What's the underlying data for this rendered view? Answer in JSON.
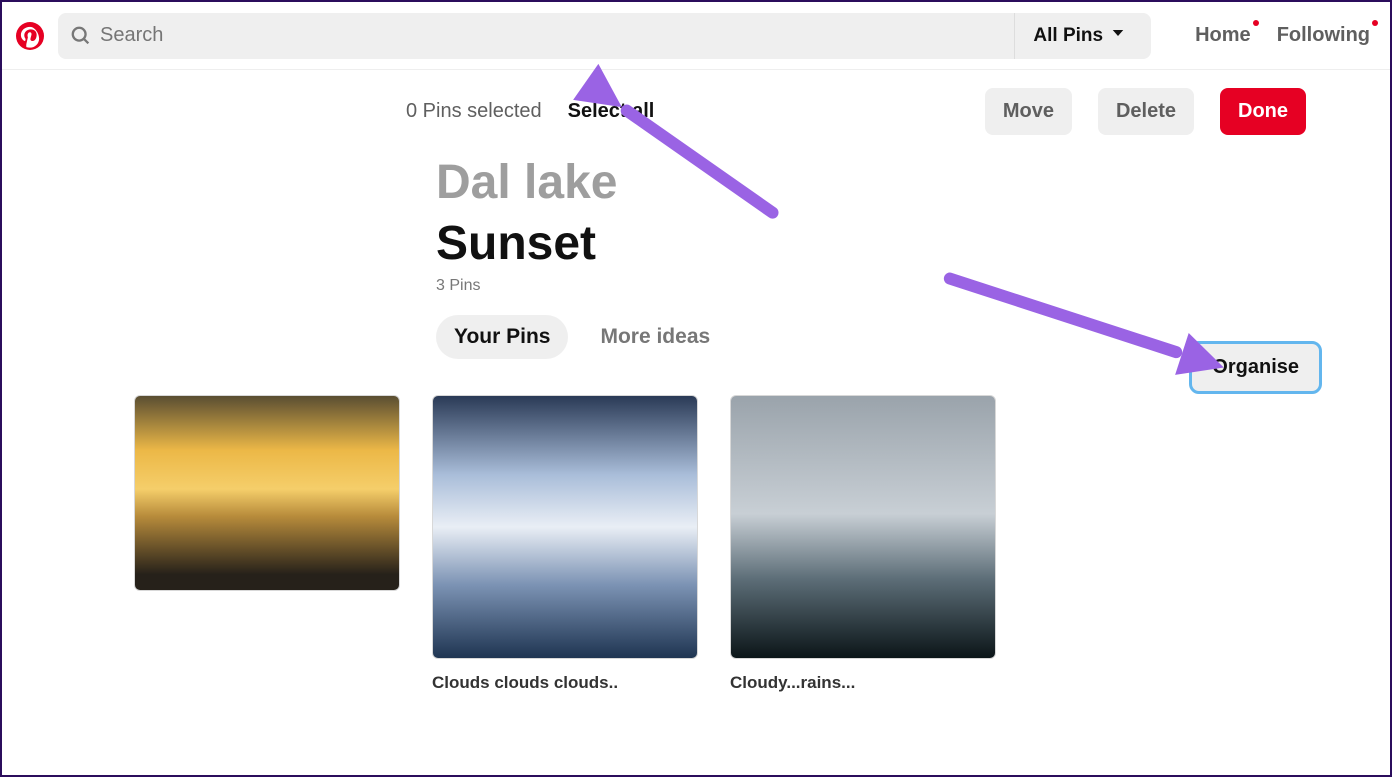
{
  "header": {
    "search_placeholder": "Search",
    "filter_label": "All Pins",
    "nav": {
      "home": "Home",
      "following": "Following"
    }
  },
  "toolbar": {
    "pins_selected": "0 Pins selected",
    "select_all": "Select all",
    "move": "Move",
    "delete": "Delete",
    "done": "Done"
  },
  "board": {
    "breadcrumb": "Dal lake",
    "title": "Sunset",
    "pin_count": "3 Pins",
    "tabs": {
      "your_pins": "Your Pins",
      "more_ideas": "More ideas"
    },
    "organise": "Organise"
  },
  "pins": [
    {
      "caption": ""
    },
    {
      "caption": "Clouds clouds clouds.."
    },
    {
      "caption": "Cloudy...rains..."
    }
  ]
}
